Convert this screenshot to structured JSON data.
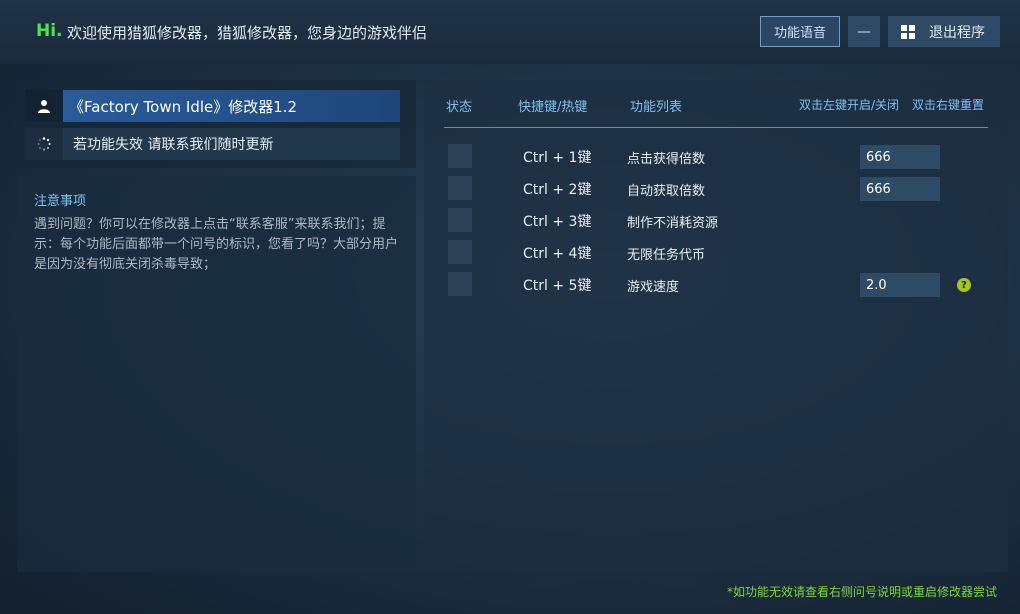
{
  "header": {
    "hi": "Hi.",
    "welcome": "欢迎使用猎狐修改器，猎狐修改器，您身边的游戏伴侣",
    "voice_button": "功能语音",
    "minimize": "—",
    "exit_button": "退出程序"
  },
  "left": {
    "title": "《Factory Town Idle》修改器1.2",
    "notice": "若功能失效 请联系我们随时更新",
    "note_title": "注意事项",
    "note_body": "遇到问题？你可以在修改器上点击“联系客服”来联系我们；提示：每个功能后面都带一个问号的标识，您看了吗？大部分用户是因为没有彻底关闭杀毒导致；"
  },
  "table": {
    "col_status": "状态",
    "col_hotkey": "快捷键/热键",
    "col_function": "功能列表",
    "hint_left": "双击左键开启/关闭",
    "hint_right": "双击右键重置",
    "rows": [
      {
        "hotkey": "Ctrl + 1键",
        "name": "点击获得倍数",
        "value": "666"
      },
      {
        "hotkey": "Ctrl + 2键",
        "name": "自动获取倍数",
        "value": "666"
      },
      {
        "hotkey": "Ctrl + 3键",
        "name": "制作不消耗资源"
      },
      {
        "hotkey": "Ctrl + 4键",
        "name": "无限任务代币"
      },
      {
        "hotkey": "Ctrl + 5键",
        "name": "游戏速度",
        "value": "2.0",
        "help": "?"
      }
    ]
  },
  "footer": "*如功能无效请查看右侧问号说明或重启修改器尝试"
}
